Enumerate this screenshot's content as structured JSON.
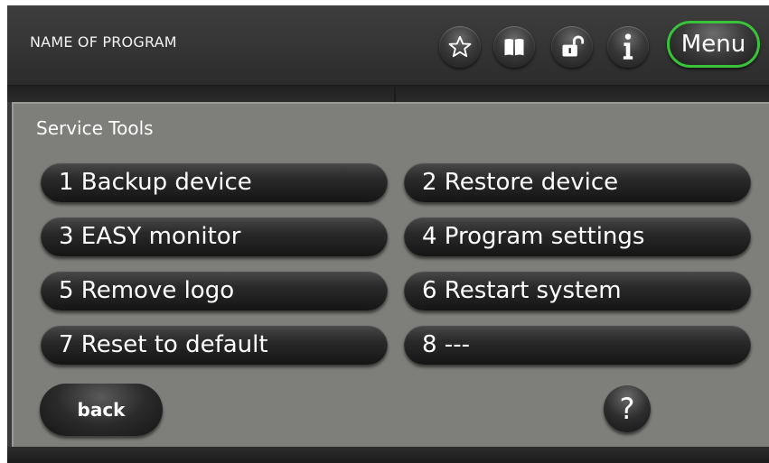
{
  "header": {
    "title": "NAME OF PROGRAM",
    "icons": [
      "star-icon",
      "book-icon",
      "unlock-icon",
      "info-icon"
    ],
    "menu_label": "Menu",
    "menu_accent": "#39c33a"
  },
  "panel": {
    "title": "Service Tools",
    "tools": [
      {
        "label": "1 Backup device"
      },
      {
        "label": "2 Restore device"
      },
      {
        "label": "3 EASY monitor"
      },
      {
        "label": "4 Program settings"
      },
      {
        "label": "5 Remove logo"
      },
      {
        "label": "6 Restart system"
      },
      {
        "label": "7 Reset to default"
      },
      {
        "label": "8 ---"
      }
    ],
    "back_label": "back",
    "help_label": "?"
  }
}
